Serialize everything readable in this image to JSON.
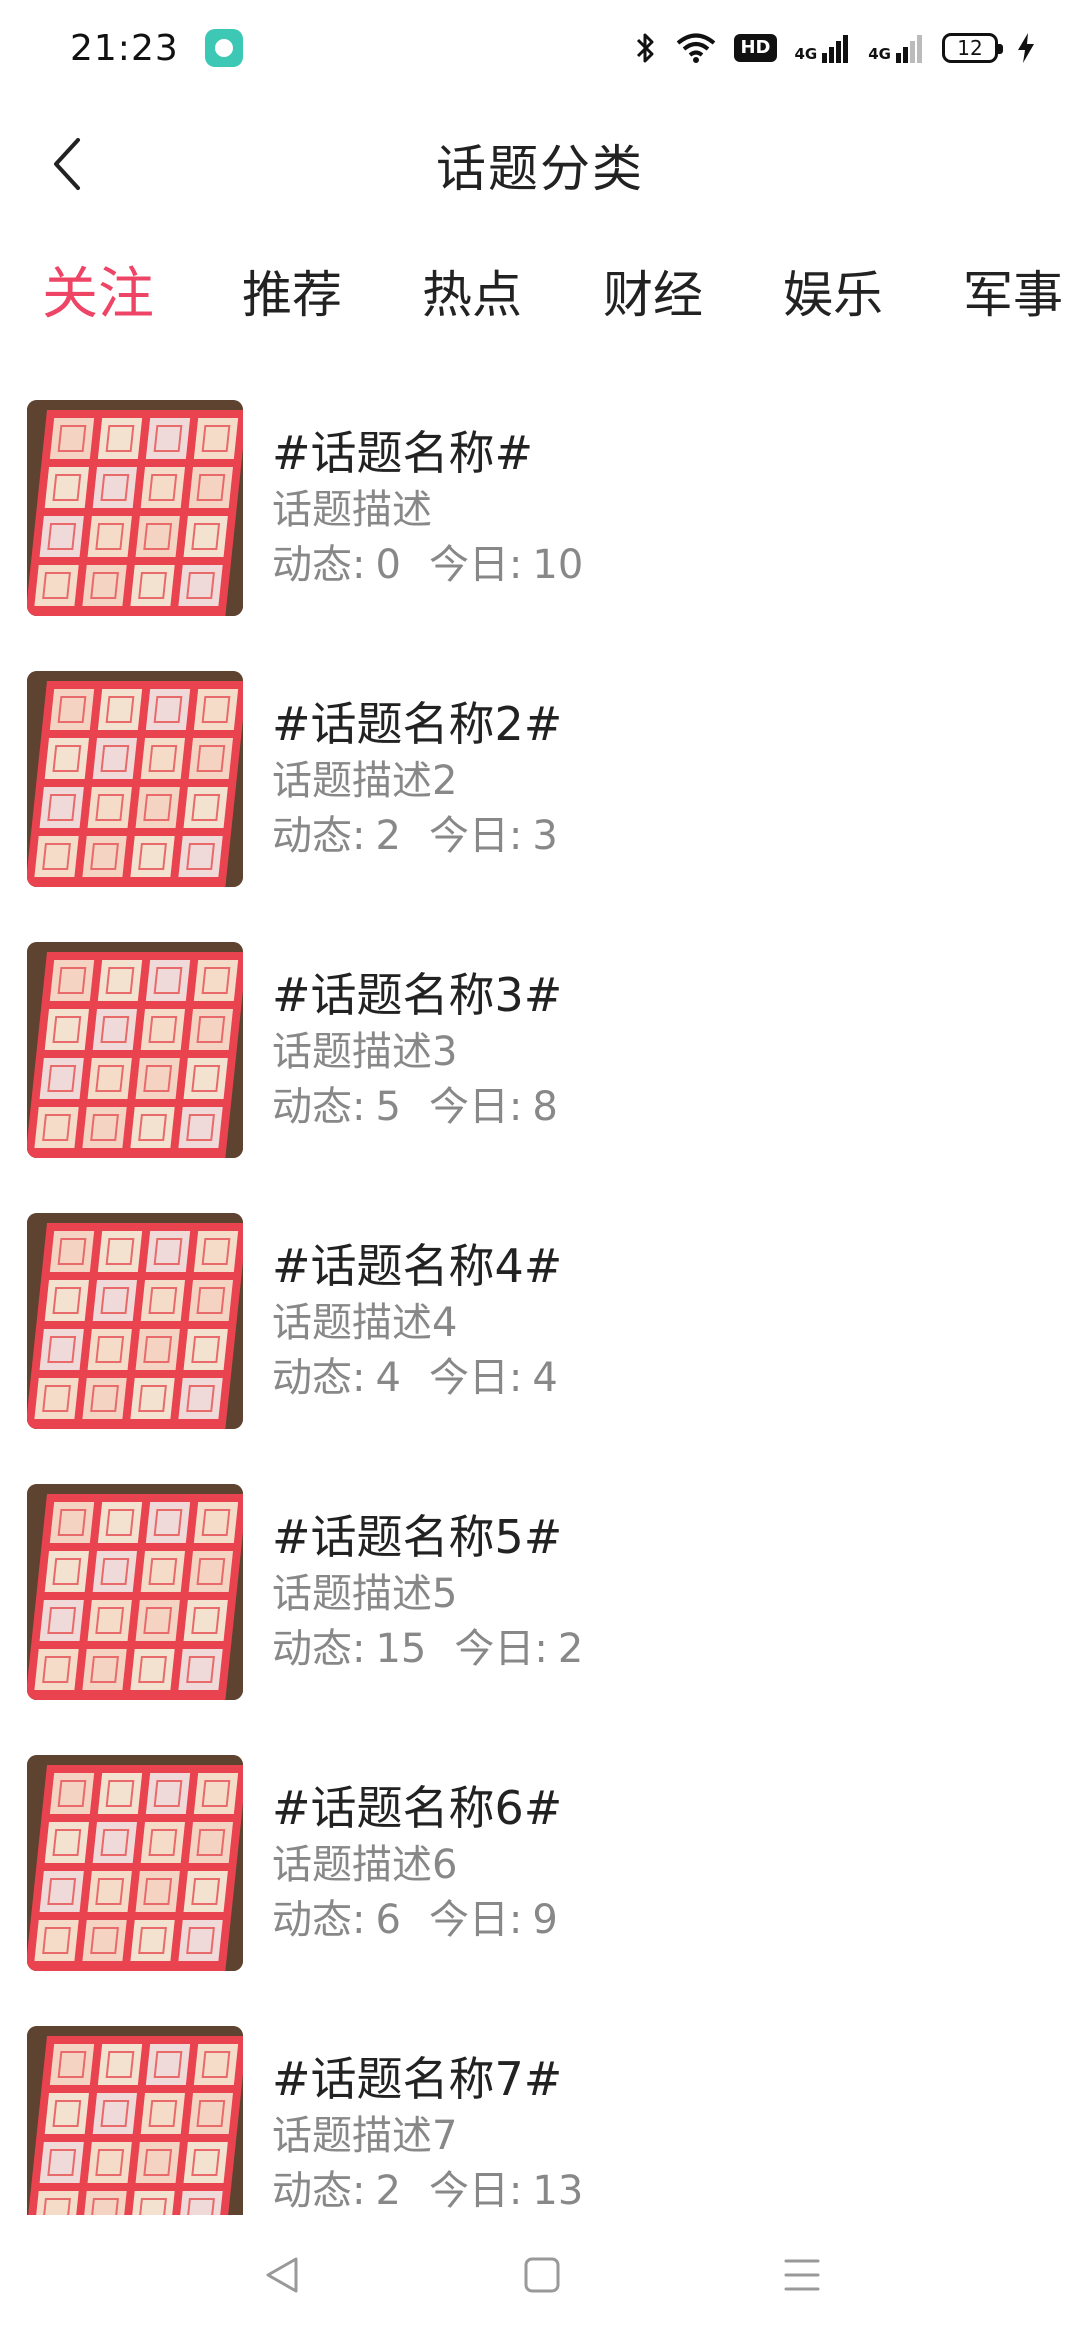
{
  "status_bar": {
    "time": "21:23",
    "network_label_1": "4G",
    "network_label_2": "4G",
    "hd_label": "HD",
    "battery_level": "12"
  },
  "header": {
    "title": "话题分类"
  },
  "tabs": [
    {
      "label": "关注",
      "active": true
    },
    {
      "label": "推荐",
      "active": false
    },
    {
      "label": "热点",
      "active": false
    },
    {
      "label": "财经",
      "active": false
    },
    {
      "label": "娱乐",
      "active": false
    },
    {
      "label": "军事",
      "active": false
    }
  ],
  "colors": {
    "accent": "#ee4466",
    "text_primary": "#222222",
    "text_secondary": "#888888"
  },
  "topics": [
    {
      "name": "#话题名称#",
      "desc": "话题描述",
      "dynamic_label": "动态:",
      "dynamic": "0",
      "today_label": "今日:",
      "today": "10"
    },
    {
      "name": "#话题名称2#",
      "desc": "话题描述2",
      "dynamic_label": "动态:",
      "dynamic": "2",
      "today_label": "今日:",
      "today": "3"
    },
    {
      "name": "#话题名称3#",
      "desc": "话题描述3",
      "dynamic_label": "动态:",
      "dynamic": "5",
      "today_label": "今日:",
      "today": "8"
    },
    {
      "name": "#话题名称4#",
      "desc": "话题描述4",
      "dynamic_label": "动态:",
      "dynamic": "4",
      "today_label": "今日:",
      "today": "4"
    },
    {
      "name": "#话题名称5#",
      "desc": "话题描述5",
      "dynamic_label": "动态:",
      "dynamic": "15",
      "today_label": "今日:",
      "today": "2"
    },
    {
      "name": "#话题名称6#",
      "desc": "话题描述6",
      "dynamic_label": "动态:",
      "dynamic": "6",
      "today_label": "今日:",
      "today": "9"
    },
    {
      "name": "#话题名称7#",
      "desc": "话题描述7",
      "dynamic_label": "动态:",
      "dynamic": "2",
      "today_label": "今日:",
      "today": "13"
    }
  ],
  "icons": {
    "back": "chevron-left-icon",
    "nav_back": "triangle-back-icon",
    "nav_home": "square-home-icon",
    "nav_menu": "menu-lines-icon"
  }
}
